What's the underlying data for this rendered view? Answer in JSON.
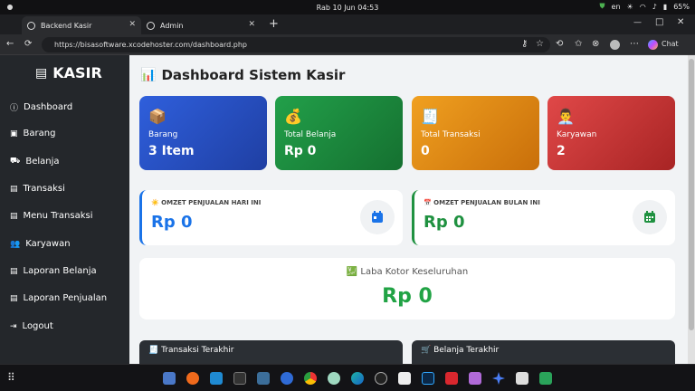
{
  "system": {
    "datetime": "Rab 10 Jun  04:53",
    "language": "en",
    "battery": "65%"
  },
  "tabs": [
    {
      "label": "Backend Kasir",
      "active": true
    },
    {
      "label": "Admin",
      "active": false
    }
  ],
  "address": {
    "url": "https://bisasoftware.xcodehoster.com/dashboard.php",
    "chat_label": "Chat"
  },
  "sidebar": {
    "brand": "KASIR",
    "items": [
      {
        "label": "Dashboard",
        "icon": "info-circle-icon"
      },
      {
        "label": "Barang",
        "icon": "box-icon"
      },
      {
        "label": "Belanja",
        "icon": "cart-icon"
      },
      {
        "label": "Transaksi",
        "icon": "document-icon"
      },
      {
        "label": "Menu Transaksi",
        "icon": "document-icon"
      },
      {
        "label": "Karyawan",
        "icon": "users-icon"
      },
      {
        "label": "Laporan Belanja",
        "icon": "document-icon"
      },
      {
        "label": "Laporan Penjualan",
        "icon": "document-icon"
      },
      {
        "label": "Logout",
        "icon": "logout-icon"
      }
    ]
  },
  "main": {
    "title": "Dashboard Sistem Kasir",
    "stats": [
      {
        "label": "Barang",
        "value": "3 Item",
        "icon": "package-icon",
        "color": "#2f5fdc"
      },
      {
        "label": "Total Belanja",
        "value": "Rp 0",
        "icon": "money-bag-icon",
        "color": "#1f9140"
      },
      {
        "label": "Total Transaksi",
        "value": "0",
        "icon": "receipt-icon",
        "color": "#e08a12"
      },
      {
        "label": "Karyawan",
        "value": "2",
        "icon": "worker-icon",
        "color": "#d73a3a"
      }
    ],
    "omzet_today": {
      "title": "OMZET PENJUALAN HARI INI",
      "value": "Rp 0",
      "color": "#1a73e8"
    },
    "omzet_month": {
      "title": "OMZET PENJUALAN BULAN INI",
      "value": "Rp 0",
      "color": "#1f9140"
    },
    "gross_profit": {
      "title": "Laba Kotor Keseluruhan",
      "value": "Rp 0"
    },
    "recent_transactions": {
      "title": "Transaksi Terakhir"
    },
    "recent_purchases": {
      "title": "Belanja Terakhir"
    }
  }
}
